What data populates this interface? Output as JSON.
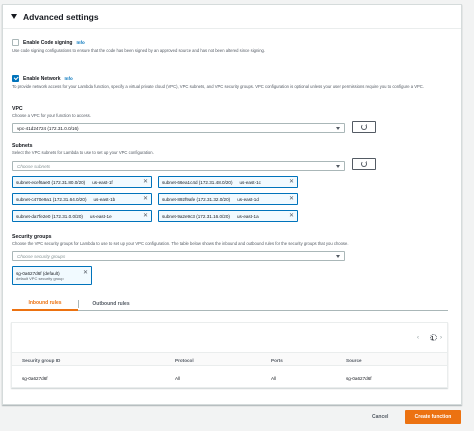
{
  "advanced": {
    "title": "Advanced settings"
  },
  "code_signing": {
    "label": "Enable Code signing",
    "info": "Info",
    "description": "Use code signing configurations to ensure that the code has been signed by an approved source and has not been altered since signing.",
    "checked": false
  },
  "network": {
    "label": "Enable Network",
    "info": "Info",
    "description": "To provide network access for your Lambda function, specify a virtual private cloud (VPC), VPC subnets, and VPC security groups. VPC configuration is optional unless your user permissions require you to configure a VPC.",
    "checked": true
  },
  "vpc": {
    "label": "VPC",
    "description": "Choose a VPC for your function to access.",
    "selected": "vpc-41d24724 (172.31.0.0/16)"
  },
  "subnets": {
    "label": "Subnets",
    "description": "Select the VPC subnets for Lambda to use to set up your VPC configuration.",
    "placeholder": "Choose subnets",
    "items": [
      {
        "id": "subnet-ecef6ae0 (172.31.80.0/20)",
        "az": "us-east-1f"
      },
      {
        "id": "subnet-66ea1c4d (172.31.48.0/20)",
        "az": "us-east-1c"
      },
      {
        "id": "subnet-c470e9a1 (172.31.64.0/20)",
        "az": "us-east-1b"
      },
      {
        "id": "subnet-892f9afe (172.31.32.0/20)",
        "az": "us-east-1d"
      },
      {
        "id": "subnet-da7fe2e0 (172.31.0.0/20)",
        "az": "us-east-1e"
      },
      {
        "id": "subnet-9a2e9c3 (172.31.16.0/20)",
        "az": "us-east-1a"
      }
    ]
  },
  "security_groups": {
    "label": "Security groups",
    "description": "Choose the VPC security groups for Lambda to use to set up your VPC configuration. The table below shows the inbound and outbound rules for the security groups that you choose.",
    "placeholder": "Choose security groups",
    "selected_name": "sg-0a627d6f (default)",
    "selected_sub": "default VPC security group"
  },
  "rules_tabs": {
    "inbound": "Inbound rules",
    "outbound": "Outbound rules"
  },
  "rules_table": {
    "page": "1",
    "columns": [
      "Security group ID",
      "Protocol",
      "Ports",
      "Source"
    ],
    "rows": [
      [
        "sg-0a627d6f",
        "All",
        "All",
        "sg-0a627d6f"
      ]
    ]
  },
  "footer": {
    "cancel": "Cancel",
    "create": "Create function"
  },
  "colors": {
    "accent": "#ec7211",
    "link": "#0073bb"
  },
  "icons": [
    "caret-down-icon",
    "refresh-icon",
    "close-icon",
    "chevron-left-icon",
    "chevron-right-icon",
    "gear-icon"
  ]
}
